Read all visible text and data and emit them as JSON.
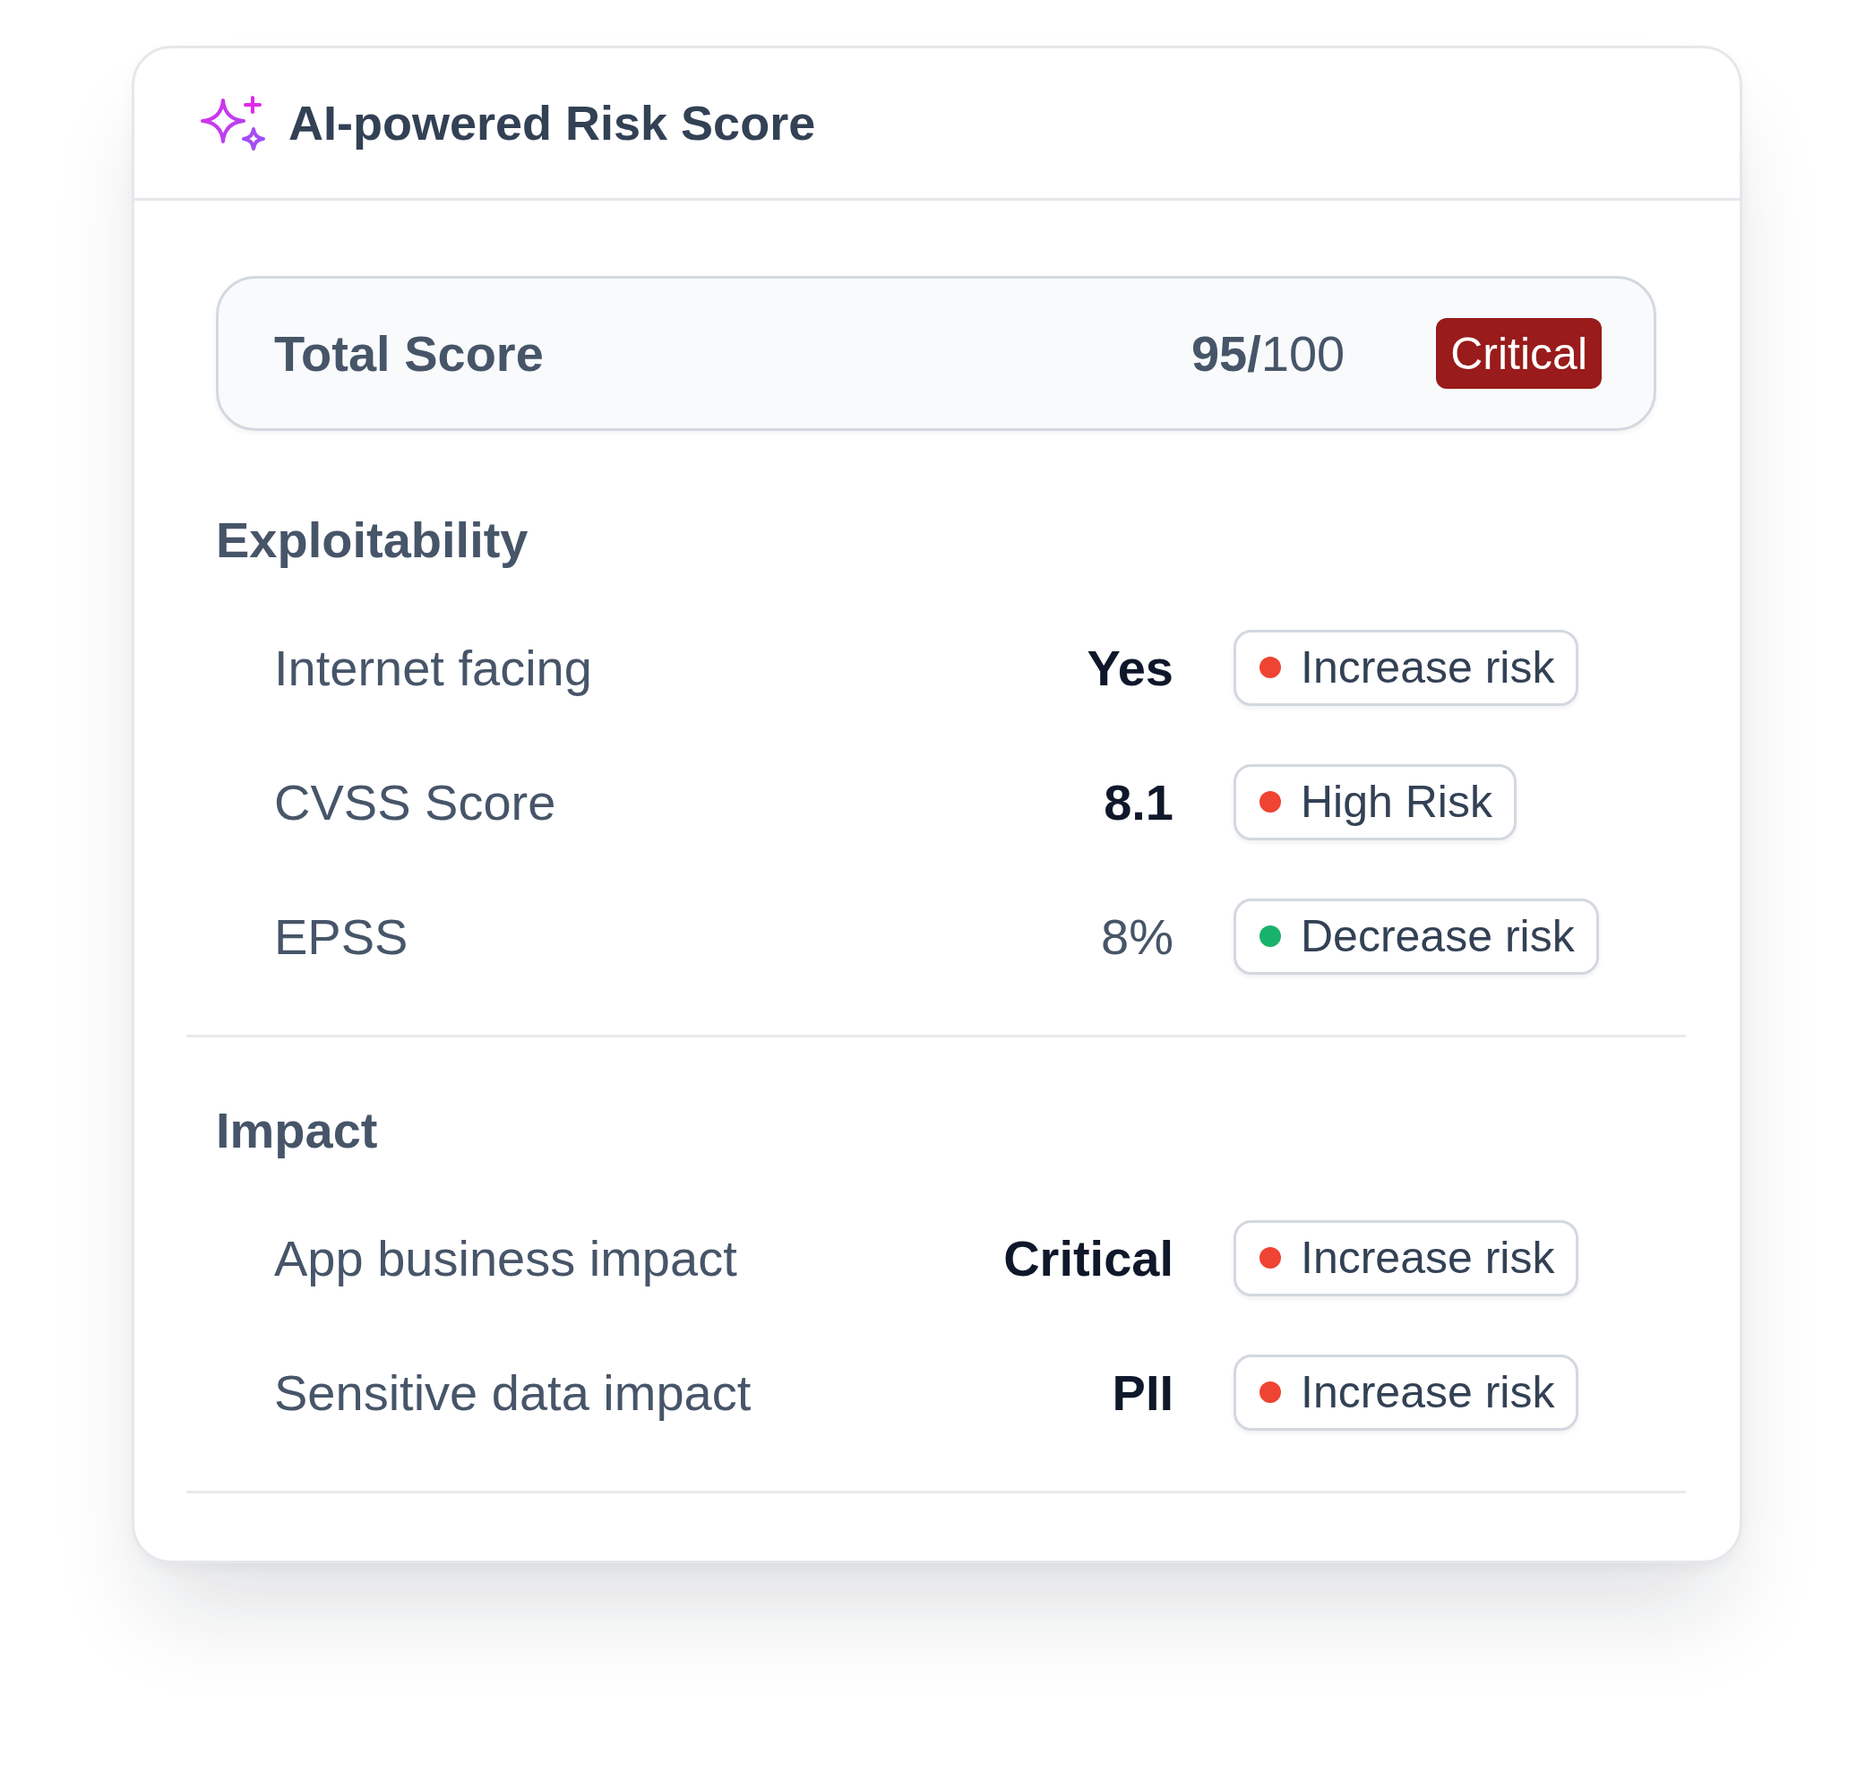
{
  "header": {
    "title": "AI-powered Risk Score"
  },
  "total_score": {
    "label": "Total Score",
    "score": "**95/**100",
    "severity": "Critical"
  },
  "sections": [
    {
      "title": "Exploitability",
      "rows": [
        {
          "label": "Internet facing",
          "value": "Yes",
          "value_bold": true,
          "effect": "Increase risk",
          "color": "#ef4433"
        },
        {
          "label": "CVSS Score",
          "value": "8.1",
          "value_bold": true,
          "effect": "High Risk",
          "color": "#ef4433"
        },
        {
          "label": "EPSS",
          "value": "8%",
          "value_bold": false,
          "effect": "Decrease risk",
          "color": "#18b26b"
        }
      ]
    },
    {
      "title": "Impact",
      "rows": [
        {
          "label": "App business impact",
          "value": "Critical",
          "value_bold": true,
          "effect": "Increase risk",
          "color": "#ef4433"
        },
        {
          "label": "Sensitive data impact",
          "value": "PII",
          "value_bold": true,
          "effect": "Increase risk",
          "color": "#ef4433"
        }
      ]
    }
  ]
}
